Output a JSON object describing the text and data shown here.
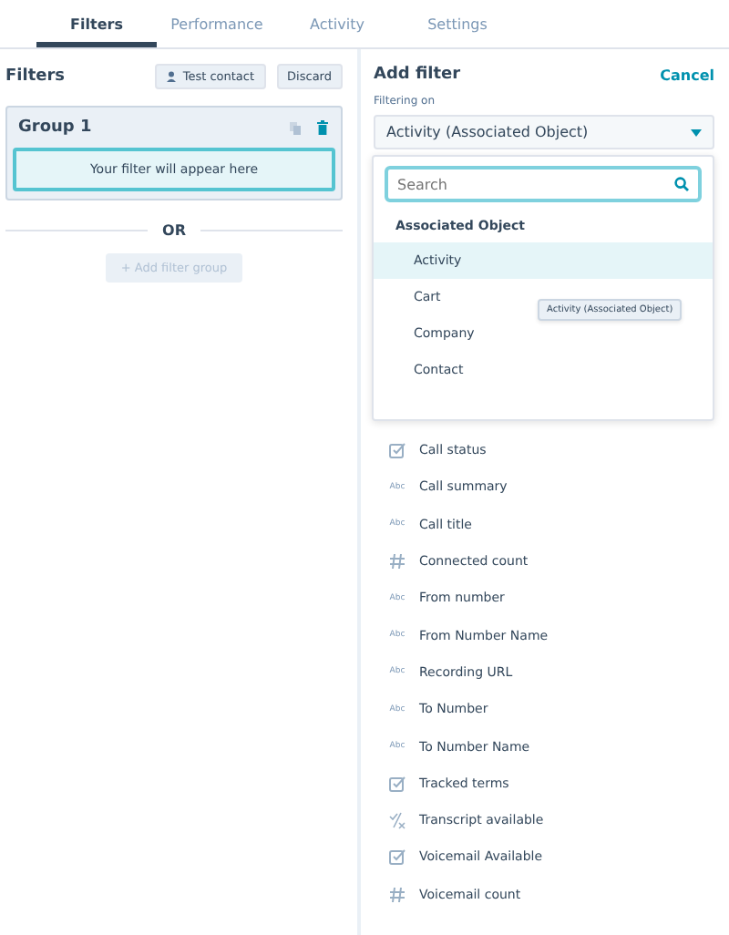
{
  "tabs": [
    {
      "label": "Filters",
      "selected": true
    },
    {
      "label": "Performance",
      "selected": false
    },
    {
      "label": "Activity",
      "selected": false
    },
    {
      "label": "Settings",
      "selected": false
    }
  ],
  "filters_panel": {
    "title": "Filters",
    "test_contact_button": "Test contact",
    "discard_button": "Discard",
    "group": {
      "title": "Group 1",
      "placeholder": "Your filter will appear here"
    },
    "separator": "OR",
    "add_group_button": {
      "label": "+ Add filter group",
      "disabled": true
    }
  },
  "add_filter": {
    "title": "Add filter",
    "cancel": "Cancel",
    "filtering_on_label": "Filtering on",
    "filtering_on_value": "Activity (Associated Object)",
    "dropdown": {
      "search_placeholder": "Search",
      "section": "Associated Object",
      "options": [
        {
          "label": "Activity",
          "selected": true
        },
        {
          "label": "Cart",
          "selected": false
        },
        {
          "label": "Company",
          "selected": false
        },
        {
          "label": "Contact",
          "selected": false
        }
      ],
      "tooltip": "Activity (Associated Object)"
    },
    "properties": [
      {
        "kind": "checkbox",
        "label": "Call status"
      },
      {
        "kind": "text",
        "type_label": "Abc",
        "label": "Call summary"
      },
      {
        "kind": "text",
        "type_label": "Abc",
        "label": "Call title"
      },
      {
        "kind": "number",
        "label": "Connected count"
      },
      {
        "kind": "text",
        "type_label": "Abc",
        "label": "From number"
      },
      {
        "kind": "text",
        "type_label": "Abc",
        "label": "From Number Name"
      },
      {
        "kind": "text",
        "type_label": "Abc",
        "label": "Recording URL"
      },
      {
        "kind": "text",
        "type_label": "Abc",
        "label": "To Number"
      },
      {
        "kind": "text",
        "type_label": "Abc",
        "label": "To Number Name"
      },
      {
        "kind": "checkbox",
        "label": "Tracked terms"
      },
      {
        "kind": "boolean",
        "label": "Transcript available"
      },
      {
        "kind": "checkbox",
        "label": "Voicemail Available"
      },
      {
        "kind": "number",
        "label": "Voicemail count"
      }
    ]
  }
}
